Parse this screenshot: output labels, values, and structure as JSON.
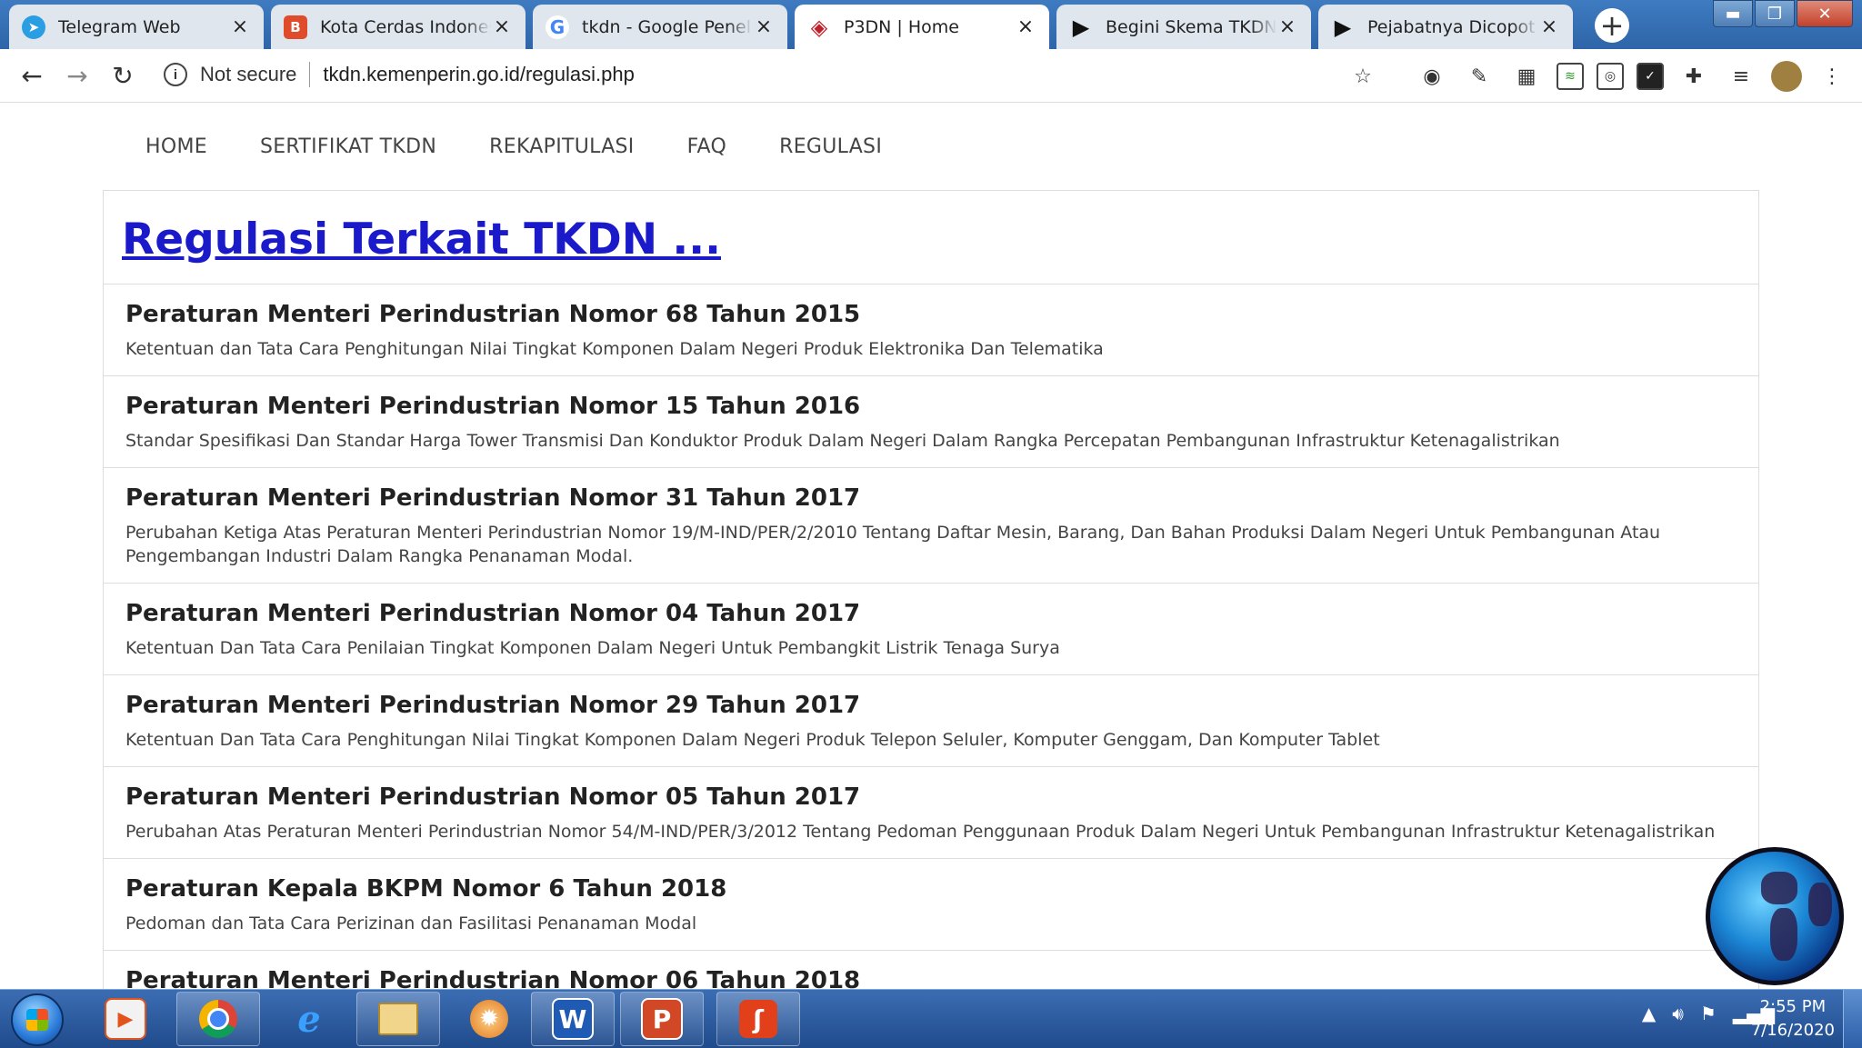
{
  "browser": {
    "tabs": [
      {
        "title": "Telegram Web",
        "icon": "telegram-icon",
        "color": "#2a9ee3",
        "active": false
      },
      {
        "title": "Kota Cerdas Indonesia",
        "icon": "blogger-icon",
        "color": "#e04b2b",
        "active": false
      },
      {
        "title": "tkdn - Google Penelusuran",
        "icon": "google-icon",
        "color": "#4285f4",
        "active": false
      },
      {
        "title": "P3DN | Home",
        "icon": "p3dn-icon",
        "color": "#c0202b",
        "active": true
      },
      {
        "title": "Begini Skema TKDN Pemerintah",
        "icon": "news-icon",
        "color": "#111111",
        "active": false
      },
      {
        "title": "Pejabatnya Dicopot jika",
        "icon": "news-icon",
        "color": "#111111",
        "active": false
      }
    ],
    "security_label": "Not secure",
    "url": "tkdn.kemenperin.go.id/regulasi.php"
  },
  "site": {
    "nav": [
      "HOME",
      "SERTIFIKAT TKDN",
      "REKAPITULASI",
      "FAQ",
      "REGULASI"
    ],
    "page_title": "Regulasi Terkait TKDN ...",
    "regulations": [
      {
        "title": "Peraturan Menteri Perindustrian Nomor 68 Tahun 2015",
        "desc": "Ketentuan dan Tata Cara Penghitungan Nilai Tingkat Komponen Dalam Negeri Produk Elektronika Dan Telematika"
      },
      {
        "title": "Peraturan Menteri Perindustrian Nomor 15 Tahun 2016",
        "desc": "Standar Spesifikasi Dan Standar Harga Tower Transmisi Dan Konduktor Produk Dalam Negeri Dalam Rangka Percepatan Pembangunan Infrastruktur Ketenagalistrikan"
      },
      {
        "title": "Peraturan Menteri Perindustrian Nomor 31 Tahun 2017",
        "desc": "Perubahan Ketiga Atas Peraturan Menteri Perindustrian Nomor 19/M-IND/PER/2/2010 Tentang Daftar Mesin, Barang, Dan Bahan Produksi Dalam Negeri Untuk Pembangunan Atau Pengembangan Industri Dalam Rangka Penanaman Modal."
      },
      {
        "title": "Peraturan Menteri Perindustrian Nomor 04 Tahun 2017",
        "desc": "Ketentuan Dan Tata Cara Penilaian Tingkat Komponen Dalam Negeri Untuk Pembangkit Listrik Tenaga Surya"
      },
      {
        "title": "Peraturan Menteri Perindustrian Nomor 29 Tahun 2017",
        "desc": "Ketentuan Dan Tata Cara Penghitungan Nilai Tingkat Komponen Dalam Negeri Produk Telepon Seluler, Komputer Genggam, Dan Komputer Tablet"
      },
      {
        "title": "Peraturan Menteri Perindustrian Nomor 05 Tahun 2017",
        "desc": "Perubahan Atas Peraturan Menteri Perindustrian Nomor 54/M-IND/PER/3/2012 Tentang Pedoman Penggunaan Produk Dalam Negeri Untuk Pembangunan Infrastruktur Ketenagalistrikan"
      },
      {
        "title": "Peraturan Kepala BKPM Nomor 6 Tahun 2018",
        "desc": "Pedoman dan Tata Cara Perizinan dan Fasilitasi Penanaman Modal"
      },
      {
        "title": "Peraturan Menteri Perindustrian Nomor 06 Tahun 2018",
        "desc": ""
      }
    ]
  },
  "taskbar": {
    "time": "2:55 PM",
    "date": "7/16/2020"
  }
}
